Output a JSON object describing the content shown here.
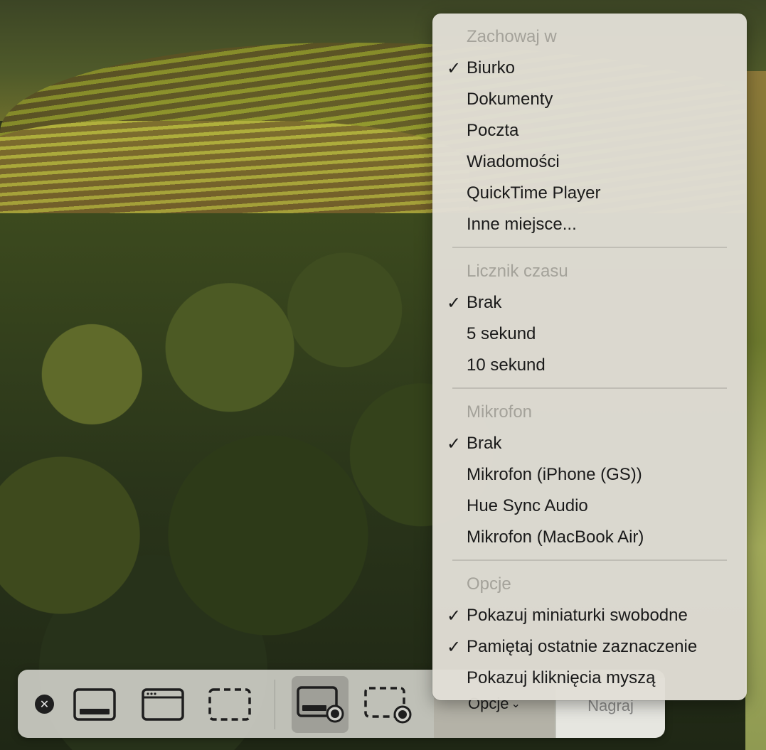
{
  "menu": {
    "sections": [
      {
        "header": "Zachowaj w",
        "items": [
          {
            "label": "Biurko",
            "checked": true
          },
          {
            "label": "Dokumenty",
            "checked": false
          },
          {
            "label": "Poczta",
            "checked": false
          },
          {
            "label": "Wiadomości",
            "checked": false
          },
          {
            "label": "QuickTime Player",
            "checked": false
          },
          {
            "label": "Inne miejsce...",
            "checked": false
          }
        ]
      },
      {
        "header": "Licznik czasu",
        "items": [
          {
            "label": "Brak",
            "checked": true
          },
          {
            "label": "5 sekund",
            "checked": false
          },
          {
            "label": "10 sekund",
            "checked": false
          }
        ]
      },
      {
        "header": "Mikrofon",
        "items": [
          {
            "label": "Brak",
            "checked": true
          },
          {
            "label": "Mikrofon (iPhone (GS))",
            "checked": false
          },
          {
            "label": "Hue Sync Audio",
            "checked": false
          },
          {
            "label": "Mikrofon (MacBook Air)",
            "checked": false
          }
        ]
      },
      {
        "header": "Opcje",
        "items": [
          {
            "label": "Pokazuj miniaturki swobodne",
            "checked": true
          },
          {
            "label": "Pamiętaj ostatnie zaznaczenie",
            "checked": true
          },
          {
            "label": "Pokazuj kliknięcia myszą",
            "checked": false
          }
        ]
      }
    ],
    "check_glyph": "✓"
  },
  "toolbar": {
    "close_glyph": "✕",
    "buttons": [
      {
        "name": "capture-entire-screen",
        "icon": "screen-capture-icon"
      },
      {
        "name": "capture-window",
        "icon": "window-capture-icon"
      },
      {
        "name": "capture-selection",
        "icon": "selection-capture-icon"
      },
      {
        "name": "record-entire-screen",
        "icon": "screen-record-icon",
        "selected": true
      },
      {
        "name": "record-selection",
        "icon": "selection-record-icon"
      }
    ],
    "options_label": "Opcje",
    "options_chevron": "⌄",
    "record_label": "Nagraj"
  },
  "colors": {
    "menu_background": "#e2dfd6",
    "menu_header_text": "#a4a29a",
    "toolbar_background": "#cdcdc6",
    "selected_button_background": "#8a8a84"
  }
}
